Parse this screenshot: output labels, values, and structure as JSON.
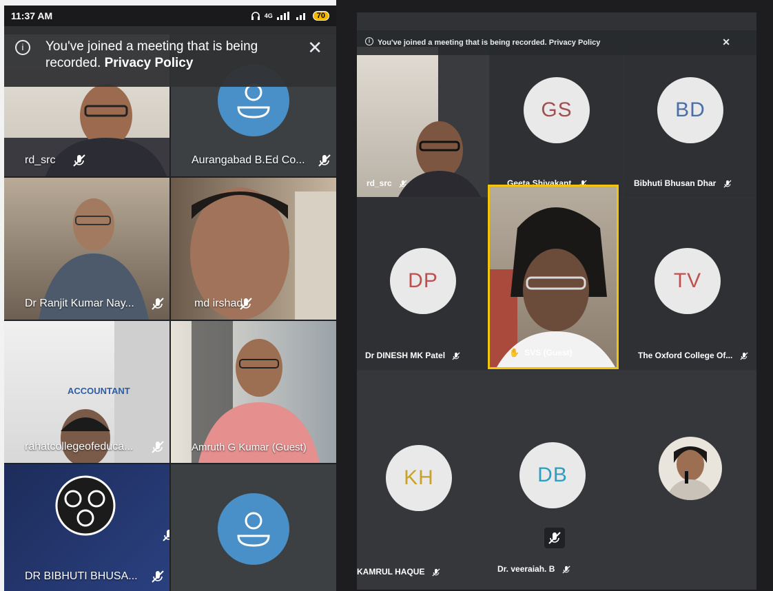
{
  "phone": {
    "status_bar": {
      "time": "11:37 AM",
      "battery": "70",
      "network": "4G"
    },
    "banner": {
      "message": "You've joined a meeting that is being recorded.",
      "link": "Privacy Policy"
    },
    "tiles": [
      {
        "name": "rd_src"
      },
      {
        "name": "Aurangabad B.Ed Co..."
      },
      {
        "name": "Dr Ranjit Kumar Nay..."
      },
      {
        "name": "md irshad"
      },
      {
        "name": "rahatcollegeofeduca...",
        "sign_text": "ACCOUNTANT"
      },
      {
        "name": "Amruth G Kumar (Guest)"
      },
      {
        "name": "DR BIBHUTI BHUSA..."
      },
      {
        "name": ""
      }
    ]
  },
  "tablet": {
    "banner": {
      "message": "You've joined a meeting that is being recorded.",
      "link": "Privacy Policy"
    },
    "tiles": [
      {
        "name": "rd_src"
      },
      {
        "name": "Geeta Shivakant",
        "initials": "GS",
        "initials_color": "#a05050"
      },
      {
        "name": "Bibhuti Bhusan Dhar",
        "initials": "BD",
        "initials_color": "#4a6fa5"
      },
      {
        "name": "Dr DINESH MK Patel",
        "initials": "DP",
        "initials_color": "#c0504d"
      },
      {
        "name": "SVS (Guest)"
      },
      {
        "name": "The Oxford College Of...",
        "initials": "TV",
        "initials_color": "#c0504d"
      },
      {
        "name": "KAMRUL HAQUE",
        "initials": "KH",
        "initials_color": "#c9a227"
      },
      {
        "name": "Dr. veeraiah. B",
        "initials": "DB",
        "initials_color": "#2a9fbf"
      },
      {
        "name": ""
      }
    ]
  }
}
